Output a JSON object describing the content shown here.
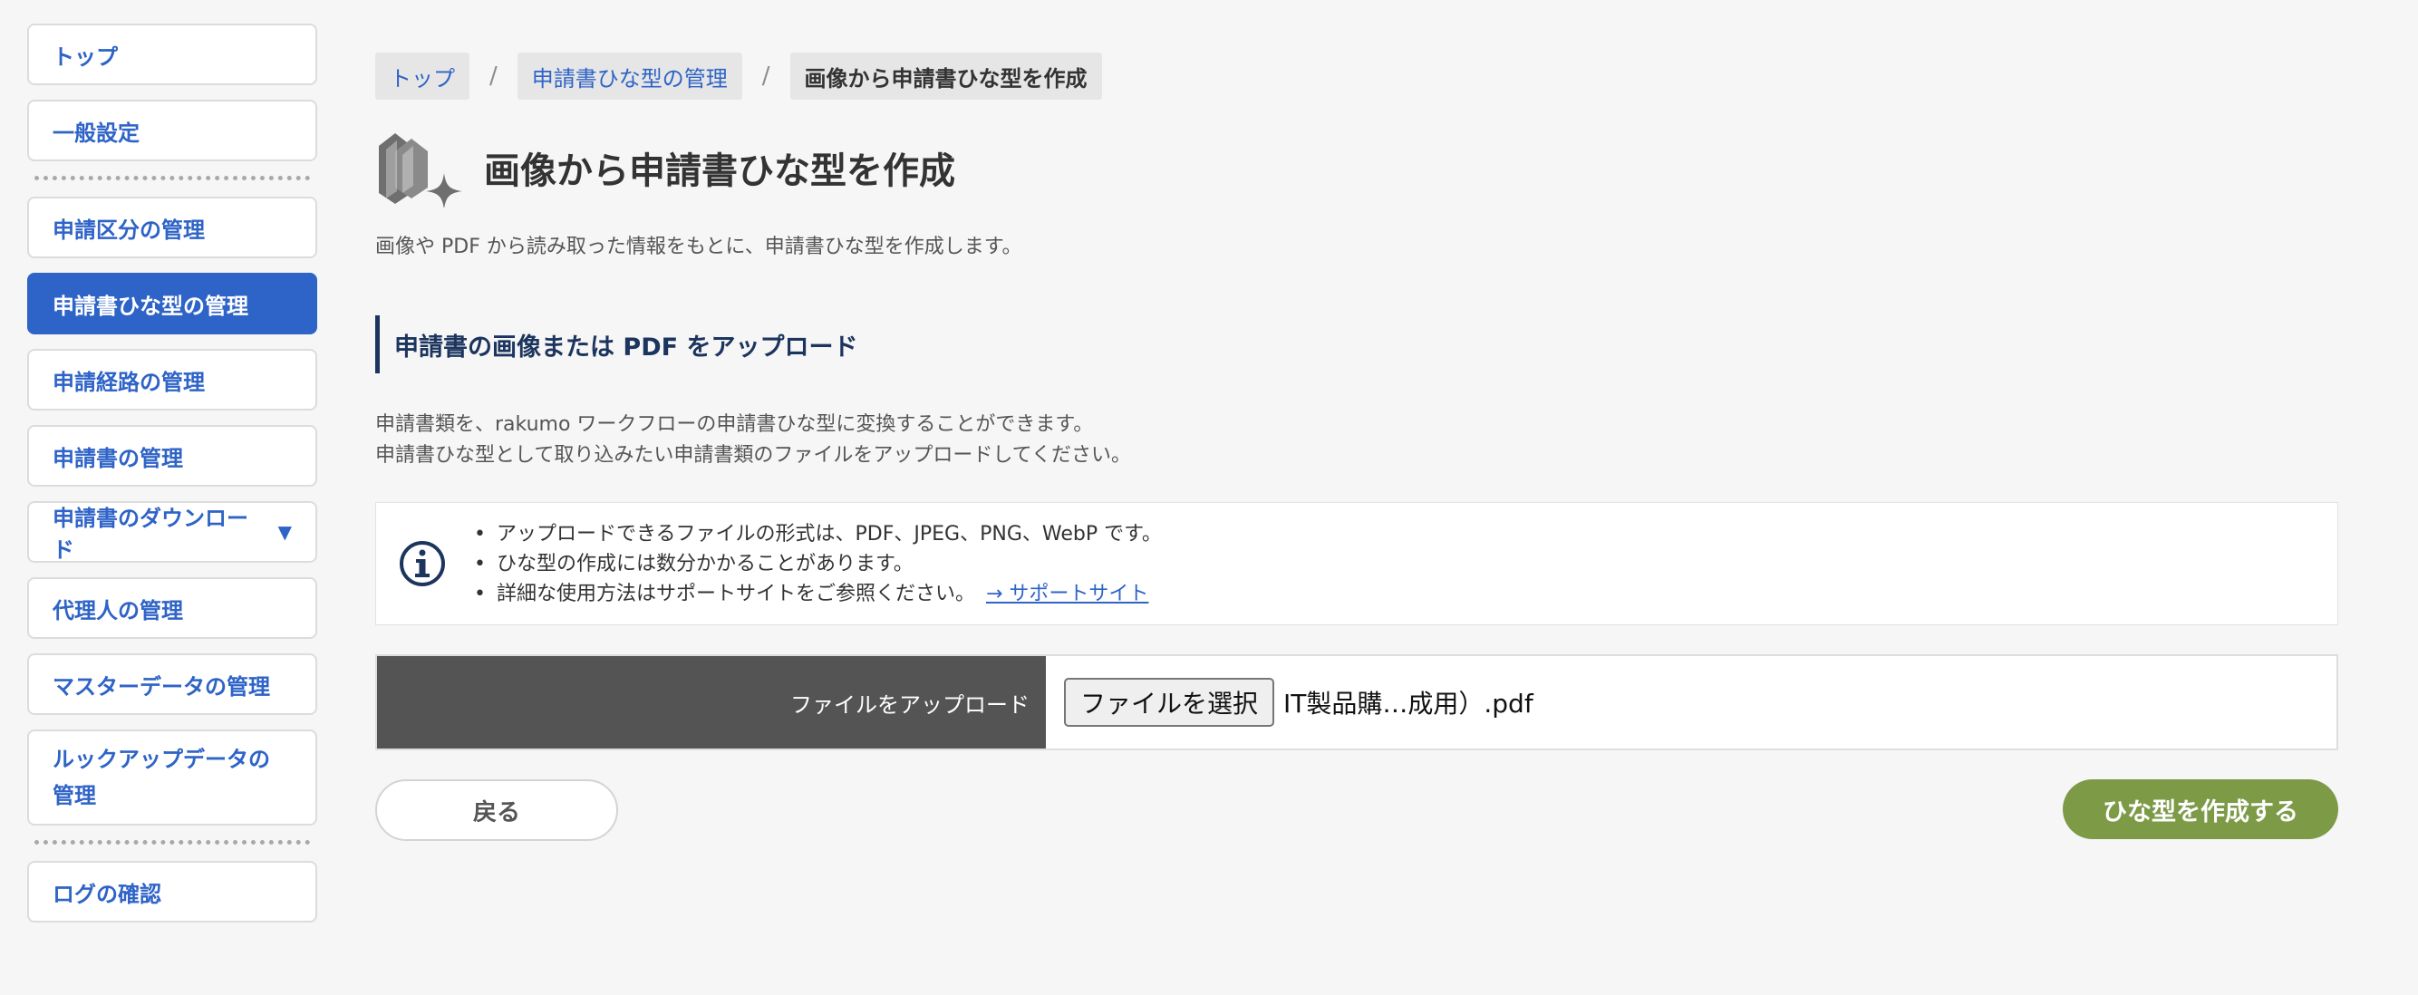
{
  "sidebar": {
    "items": [
      {
        "label": "トップ"
      },
      {
        "label": "一般設定"
      },
      {
        "label": "申請区分の管理"
      },
      {
        "label": "申請書ひな型の管理"
      },
      {
        "label": "申請経路の管理"
      },
      {
        "label": "申請書の管理"
      },
      {
        "label": "申請書のダウンロード",
        "caret": "▼"
      },
      {
        "label": "代理人の管理"
      },
      {
        "label": "マスターデータの管理"
      },
      {
        "label": "ルックアップデータの管理"
      },
      {
        "label": "ログの確認"
      }
    ]
  },
  "breadcrumb": {
    "items": [
      "トップ",
      "申請書ひな型の管理",
      "画像から申請書ひな型を作成"
    ],
    "separator": "/"
  },
  "header": {
    "title": "画像から申請書ひな型を作成",
    "description": "画像や PDF から読み取った情報をもとに、申請書ひな型を作成します。",
    "icon": "sparkle-documents-icon"
  },
  "section": {
    "heading": "申請書の画像または PDF をアップロード",
    "intro_line1": "申請書類を、rakumo ワークフローの申請書ひな型に変換することができます。",
    "intro_line2": "申請書ひな型として取り込みたい申請書類のファイルをアップロードしてください。"
  },
  "info": {
    "icon": "info-icon",
    "items": [
      "アップロードできるファイルの形式は、PDF、JPEG、PNG、WebP です。",
      "ひな型の作成には数分かかることがあります。",
      "詳細な使用方法はサポートサイトをご参照ください。"
    ],
    "link_label": "→ サポートサイト"
  },
  "upload": {
    "label": "ファイルをアップロード",
    "button_label": "ファイルを選択",
    "file_name": "IT製品購…成用）.pdf"
  },
  "actions": {
    "back_label": "戻る",
    "create_label": "ひな型を作成する"
  },
  "colors": {
    "accent": "#2e63c7",
    "heading": "#1c355e",
    "create_button": "#7d9a47",
    "upload_label_bg": "#545454"
  }
}
